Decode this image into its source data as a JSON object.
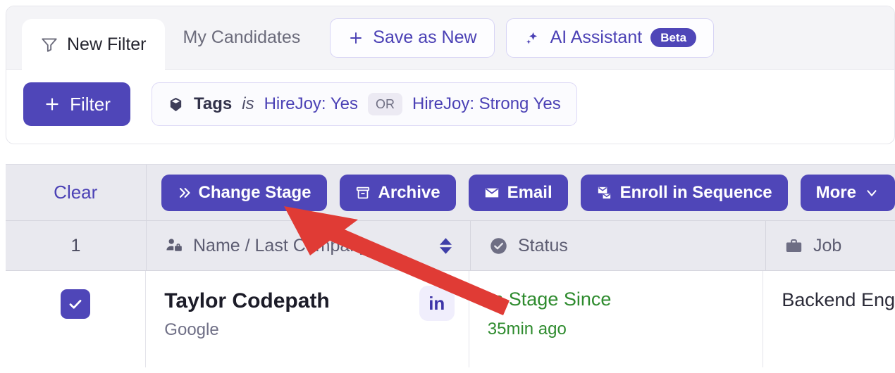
{
  "tabs": [
    {
      "label": "New Filter",
      "icon": "funnel-icon",
      "active": true
    },
    {
      "label": "My Candidates",
      "icon": "",
      "active": false
    }
  ],
  "tab_actions": {
    "save_as_new": {
      "label": "Save as New",
      "icon": "plus-icon"
    },
    "ai_assistant": {
      "label": "AI Assistant",
      "icon": "sparkles-icon",
      "badge": "Beta"
    }
  },
  "filter_row": {
    "filter_button": {
      "label": "Filter",
      "icon": "plus-icon"
    },
    "chip": {
      "icon": "tag-cube-icon",
      "field": "Tags",
      "operator": "is",
      "value_1": "HireJoy: Yes",
      "conjunction": "OR",
      "value_2": "HireJoy: Strong Yes"
    }
  },
  "action_bar": {
    "clear_label": "Clear",
    "buttons": [
      {
        "label": "Change Stage",
        "icon": "double-chevron-right-icon"
      },
      {
        "label": "Archive",
        "icon": "archive-box-icon"
      },
      {
        "label": "Email",
        "icon": "envelope-icon"
      },
      {
        "label": "Enroll in Sequence",
        "icon": "sequence-icon"
      },
      {
        "label": "More",
        "icon": "chevron-down-icon"
      }
    ]
  },
  "table": {
    "selected_count": "1",
    "columns": [
      {
        "label": "Name / Last Company",
        "icon": "person-briefcase-icon",
        "sortable": true
      },
      {
        "label": "Status",
        "icon": "check-circle-icon",
        "sortable": false
      },
      {
        "label": "Job",
        "icon": "briefcase-icon",
        "sortable": false
      }
    ],
    "rows": [
      {
        "checked": true,
        "name": "Taylor Codepath",
        "company": "Google",
        "social": "in",
        "status_label": "In Stage Since",
        "status_time": "35min ago",
        "job": "Backend Eng"
      }
    ]
  },
  "annotation": {
    "type": "arrow",
    "color": "#e03b35",
    "points_to": "change-stage-button"
  },
  "colors": {
    "primary": "#4f46b8",
    "primary_soft": "#f0eefc",
    "toolbar_bg": "#e9e9ef",
    "tabstrip_bg": "#f4f4f7",
    "status_green": "#2e8b2e",
    "annotation_red": "#e03b35"
  }
}
